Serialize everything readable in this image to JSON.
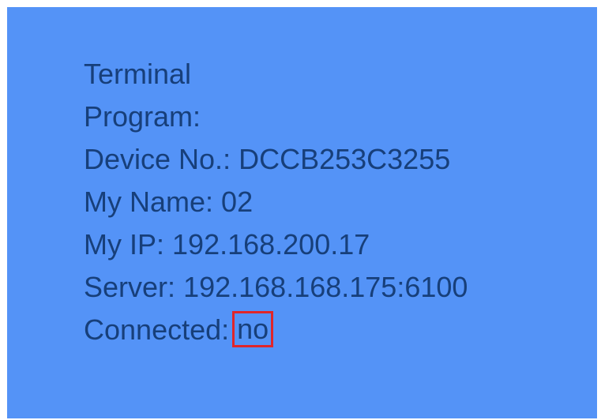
{
  "status": {
    "terminal_label": "Terminal",
    "program_label": "Program:",
    "device_label": "Device No.:",
    "device_value": "DCCB253C3255",
    "name_label": "My Name:",
    "name_value": "02",
    "ip_label": "My IP:",
    "ip_value": "192.168.200.17",
    "server_label": "Server:",
    "server_value": "192.168.168.175:6100",
    "connected_label": "Connected:",
    "connected_value": "no"
  },
  "colors": {
    "background": "#5493f7",
    "text": "#173f7a",
    "highlight_border": "#e0262a"
  }
}
